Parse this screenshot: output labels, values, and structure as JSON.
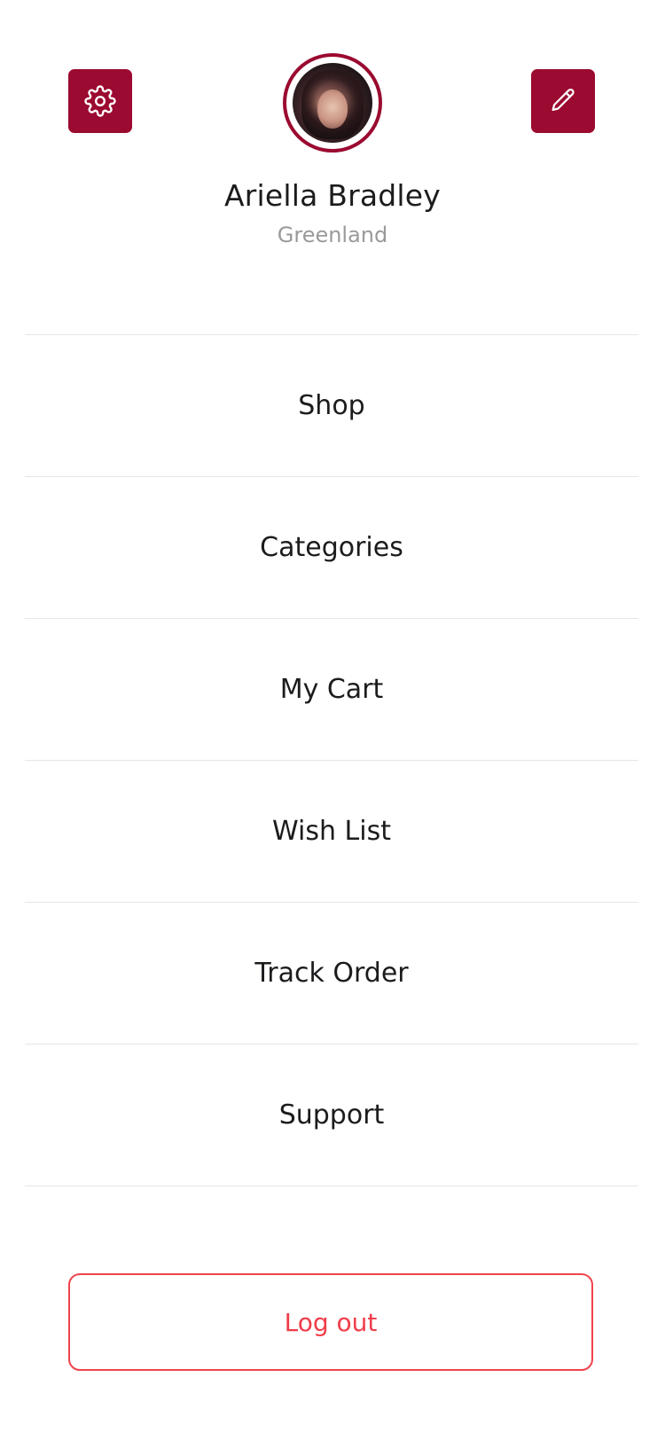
{
  "profile": {
    "name": "Ariella Bradley",
    "location": "Greenland"
  },
  "icons": {
    "settings": "gear-icon",
    "edit": "pencil-icon"
  },
  "menu": {
    "items": [
      {
        "label": "Shop"
      },
      {
        "label": "Categories"
      },
      {
        "label": "My Cart"
      },
      {
        "label": "Wish List"
      },
      {
        "label": "Track Order"
      },
      {
        "label": "Support"
      }
    ]
  },
  "actions": {
    "logout_label": "Log out"
  },
  "colors": {
    "accent": "#9b0a30",
    "logout": "#ef3d4a",
    "divider": "#e6e6e6",
    "muted_text": "#9a9a9a"
  }
}
